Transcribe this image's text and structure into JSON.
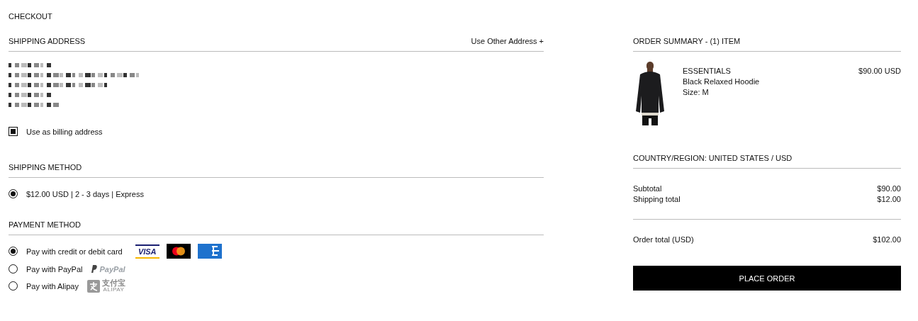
{
  "page_title": "CHECKOUT",
  "shipping_address": {
    "title": "SHIPPING ADDRESS",
    "action": "Use Other Address +",
    "billing": {
      "label": "Use as billing address",
      "checked": true
    }
  },
  "shipping_method": {
    "title": "SHIPPING METHOD",
    "options": [
      {
        "label": "$12.00 USD | 2 - 3 days | Express",
        "selected": true
      }
    ]
  },
  "payment_method": {
    "title": "PAYMENT METHOD",
    "options": [
      {
        "label": "Pay with credit or debit card",
        "selected": true,
        "kind": "cards",
        "logo_text": "VISA"
      },
      {
        "label": "Pay with PayPal",
        "selected": false,
        "kind": "paypal",
        "logo_text": "PayPal"
      },
      {
        "label": "Pay with Alipay",
        "selected": false,
        "kind": "alipay",
        "logo_text": "支付宝",
        "logo_subtext": "ALIPAY"
      }
    ]
  },
  "order_summary": {
    "title": "ORDER SUMMARY - (1) ITEM",
    "items": [
      {
        "brand": "ESSENTIALS",
        "name": "Black Relaxed Hoodie",
        "size": "Size: M",
        "price": "$90.00 USD"
      }
    ],
    "region": "COUNTRY/REGION: UNITED STATES / USD",
    "lines": [
      {
        "label": "Subtotal",
        "value": "$90.00"
      },
      {
        "label": "Shipping total",
        "value": "$12.00"
      }
    ],
    "total": {
      "label": "Order total (USD)",
      "value": "$102.00"
    },
    "button": "PLACE ORDER"
  }
}
